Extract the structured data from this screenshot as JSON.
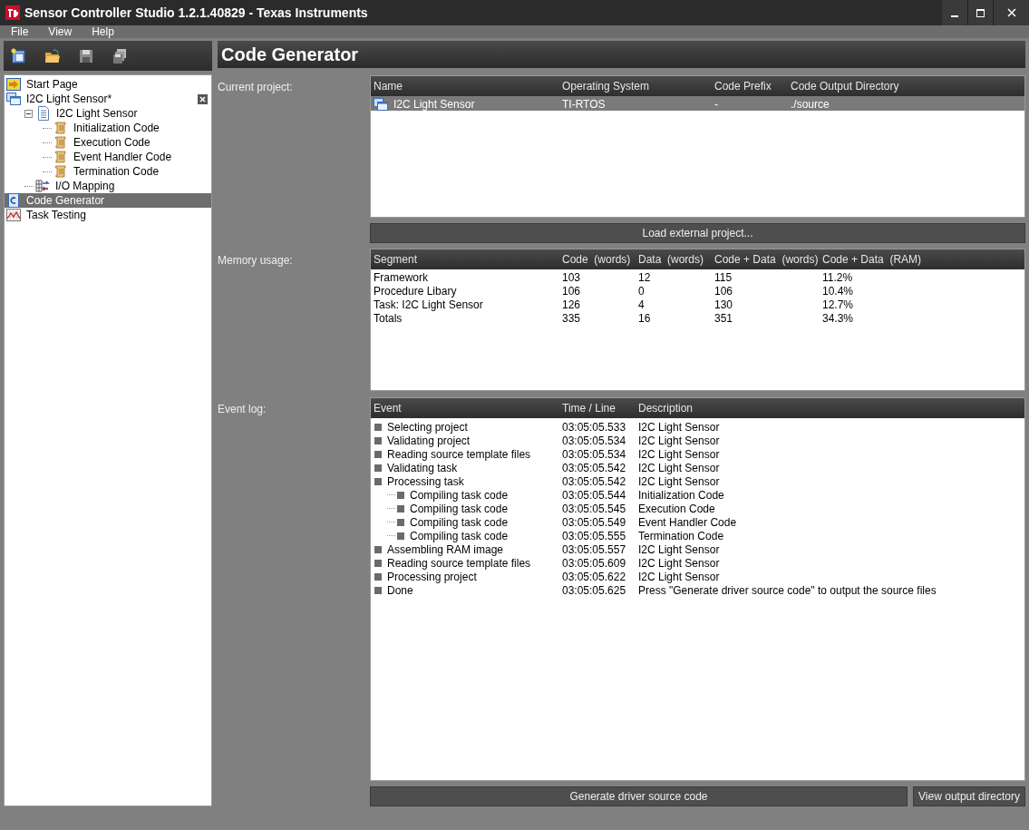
{
  "window": {
    "title": "Sensor Controller Studio 1.2.1.40829 - Texas Instruments"
  },
  "menu": [
    "File",
    "View",
    "Help"
  ],
  "tree": [
    {
      "label": "Start Page",
      "kind": "start",
      "selected": false
    },
    {
      "label": "I2C Light Sensor*",
      "kind": "project",
      "selected": false,
      "closable": true,
      "children": [
        {
          "label": "I2C Light Sensor",
          "kind": "task",
          "selected": false,
          "expanded": true,
          "children": [
            {
              "label": "Initialization Code",
              "kind": "code",
              "selected": false
            },
            {
              "label": "Execution Code",
              "kind": "code",
              "selected": false
            },
            {
              "label": "Event Handler Code",
              "kind": "code",
              "selected": false
            },
            {
              "label": "Termination Code",
              "kind": "code",
              "selected": false
            }
          ]
        },
        {
          "label": "I/O Mapping",
          "kind": "io",
          "selected": false
        }
      ]
    },
    {
      "label": "Code Generator",
      "kind": "generator",
      "selected": true
    },
    {
      "label": "Task Testing",
      "kind": "testing",
      "selected": false
    }
  ],
  "page_title": "Code Generator",
  "current_project": {
    "label": "Current project:",
    "columns": [
      "Name",
      "Operating System",
      "Code Prefix",
      "Code Output Directory"
    ],
    "rows": [
      {
        "cells": [
          "I2C Light Sensor",
          "TI-RTOS",
          "-",
          "./source"
        ],
        "selected": true
      }
    ],
    "button": "Load external project..."
  },
  "memory_usage": {
    "label": "Memory usage:",
    "columns": [
      "Segment",
      "Code  (words)",
      "Data  (words)",
      "Code + Data  (words)",
      "Code + Data  (RAM)"
    ],
    "rows": [
      [
        "Framework",
        "103",
        "12",
        "115",
        "11.2%"
      ],
      [
        "Procedure Libary",
        "106",
        "0",
        "106",
        "10.4%"
      ],
      [
        "Task: I2C Light Sensor",
        "126",
        "4",
        "130",
        "12.7%"
      ],
      [
        "Totals",
        "335",
        "16",
        "351",
        "34.3%"
      ]
    ]
  },
  "event_log": {
    "label": "Event log:",
    "columns": [
      "Event",
      "Time / Line",
      "Description"
    ],
    "rows": [
      {
        "event": "Selecting project",
        "time": "03:05:05.533",
        "description": "I2C Light Sensor"
      },
      {
        "event": "Validating project",
        "time": "03:05:05.534",
        "description": "I2C Light Sensor"
      },
      {
        "event": "Reading source template files",
        "time": "03:05:05.534",
        "description": "I2C Light Sensor"
      },
      {
        "event": "Validating task",
        "time": "03:05:05.542",
        "description": "I2C Light Sensor"
      },
      {
        "event": "Processing task",
        "time": "03:05:05.542",
        "description": "I2C Light Sensor",
        "children": [
          {
            "event": "Compiling task code",
            "time": "03:05:05.544",
            "description": "Initialization Code"
          },
          {
            "event": "Compiling task code",
            "time": "03:05:05.545",
            "description": "Execution Code"
          },
          {
            "event": "Compiling task code",
            "time": "03:05:05.549",
            "description": "Event Handler Code"
          },
          {
            "event": "Compiling task code",
            "time": "03:05:05.555",
            "description": "Termination Code"
          }
        ]
      },
      {
        "event": "Assembling RAM image",
        "time": "03:05:05.557",
        "description": "I2C Light Sensor"
      },
      {
        "event": "Reading source template files",
        "time": "03:05:05.609",
        "description": "I2C Light Sensor"
      },
      {
        "event": "Processing project",
        "time": "03:05:05.622",
        "description": "I2C Light Sensor"
      },
      {
        "event": "Done",
        "time": "03:05:05.625",
        "description": "Press \"Generate driver source code\" to output the source files"
      }
    ]
  },
  "buttons": [
    "Generate driver source code",
    "View output directory"
  ]
}
